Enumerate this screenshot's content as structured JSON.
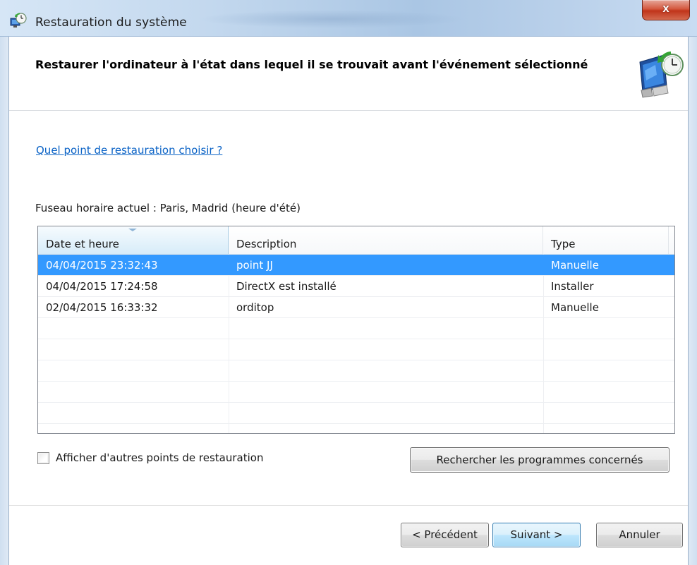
{
  "window": {
    "title": "Restauration du système",
    "close_label": "x"
  },
  "header": {
    "title": "Restaurer l'ordinateur à l'état dans lequel il se trouvait avant l'événement sélectionné",
    "icon": "system-restore-icon"
  },
  "help_link": "Quel point de restauration choisir ?",
  "timezone_text": "Fuseau horaire actuel : Paris, Madrid (heure d'été)",
  "restore_points": {
    "columns": [
      "Date et heure",
      "Description",
      "Type"
    ],
    "sorted_column": "Date et heure",
    "rows": [
      {
        "date": "04/04/2015 23:32:43",
        "description": "point JJ",
        "type": "Manuelle",
        "selected": true
      },
      {
        "date": "04/04/2015 17:24:58",
        "description": "DirectX est installé",
        "type": "Installer",
        "selected": false
      },
      {
        "date": "02/04/2015 16:33:32",
        "description": "orditop",
        "type": "Manuelle",
        "selected": false
      }
    ]
  },
  "show_more": {
    "label": "Afficher d'autres points de restauration",
    "checked": false
  },
  "buttons": {
    "scan": "Rechercher les programmes concernés",
    "back": "< Précédent",
    "next": "Suivant >",
    "cancel": "Annuler"
  },
  "colors": {
    "selection": "#3399ff",
    "link": "#0b63c6",
    "close_button": "#c0341a"
  }
}
